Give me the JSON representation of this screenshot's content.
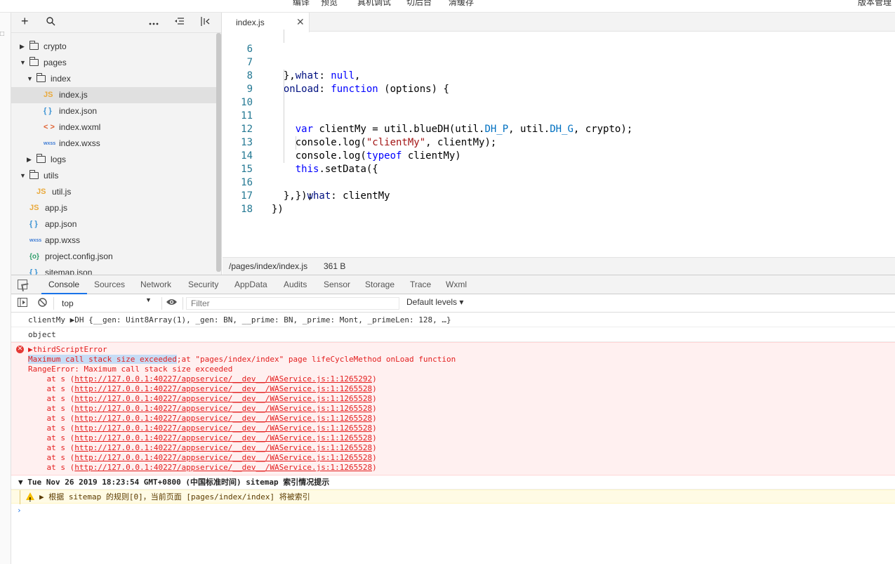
{
  "toolbar": {
    "items": [
      "编译",
      "预览",
      "真机调试",
      "切后台",
      "清缓存"
    ],
    "right": "版本管理"
  },
  "explorer": {
    "tree": [
      {
        "label": "crypto",
        "type": "folder",
        "expanded": false,
        "depth": 0
      },
      {
        "label": "pages",
        "type": "folder",
        "expanded": true,
        "depth": 0
      },
      {
        "label": "index",
        "type": "folder",
        "expanded": true,
        "depth": 1
      },
      {
        "label": "index.js",
        "type": "js",
        "depth": 2,
        "selected": true
      },
      {
        "label": "index.json",
        "type": "json",
        "depth": 2
      },
      {
        "label": "index.wxml",
        "type": "wxml",
        "depth": 2
      },
      {
        "label": "index.wxss",
        "type": "wxss",
        "depth": 2
      },
      {
        "label": "logs",
        "type": "folder",
        "expanded": false,
        "depth": 1
      },
      {
        "label": "utils",
        "type": "folder",
        "expanded": true,
        "depth": 0
      },
      {
        "label": "util.js",
        "type": "js",
        "depth": 1
      },
      {
        "label": "app.js",
        "type": "js",
        "depth": 0
      },
      {
        "label": "app.json",
        "type": "json",
        "depth": 0
      },
      {
        "label": "app.wxss",
        "type": "wxss",
        "depth": 0
      },
      {
        "label": "project.config.json",
        "type": "cfg",
        "depth": 0
      },
      {
        "label": "sitemap.json",
        "type": "json",
        "depth": 0
      }
    ]
  },
  "icons": {
    "js": "JS",
    "json": "{ }",
    "wxml": "< >",
    "wxss": "wxss",
    "cfg": "{o}"
  },
  "editor": {
    "tab_label": "index.js",
    "lines": [
      {
        "n": "6",
        "code": "    what: null,"
      },
      {
        "n": "7",
        "code": "  },"
      },
      {
        "n": "8",
        "code": "  onLoad: function (options) {"
      },
      {
        "n": "9",
        "code": ""
      },
      {
        "n": "10",
        "code": "    var clientMy = util.blueDH(util.DH_P, util.DH_G, crypto);"
      },
      {
        "n": "11",
        "code": "    console.log(\"clientMy\", clientMy);"
      },
      {
        "n": "12",
        "code": "    console.log(typeof clientMy)"
      },
      {
        "n": "13",
        "code": "    this.setData({"
      },
      {
        "n": "14",
        "code": "      what: clientMy"
      },
      {
        "n": "15",
        "code": "    });"
      },
      {
        "n": "16",
        "code": "  },"
      },
      {
        "n": "17",
        "code": "})"
      },
      {
        "n": "18",
        "code": ""
      }
    ],
    "status_path": "/pages/index/index.js",
    "status_size": "361 B"
  },
  "devtools": {
    "tabs": [
      "Console",
      "Sources",
      "Network",
      "Security",
      "AppData",
      "Audits",
      "Sensor",
      "Storage",
      "Trace",
      "Wxml"
    ],
    "active_tab": "Console",
    "context": "top",
    "filter_placeholder": "Filter",
    "levels": "Default levels ▾"
  },
  "console": {
    "log1": "clientMy ▶DH {__gen: Uint8Array(1), _gen: BN, __prime: BN, _prime: Mont, _primeLen: 128, …}",
    "log2": "object",
    "error_head": "▶thirdScriptError",
    "error_highlight": "Maximum call stack size exceeded",
    "error_msg_rest": ";at \"pages/index/index\" page lifeCycleMethod onLoad function",
    "error_type": "RangeError: Maximum call stack size exceeded",
    "stack_prefix": "    at s (",
    "stack_suffix": ")",
    "stack": [
      "http://127.0.0.1:40227/appservice/__dev__/WAService.js:1:1265292",
      "http://127.0.0.1:40227/appservice/__dev__/WAService.js:1:1265528",
      "http://127.0.0.1:40227/appservice/__dev__/WAService.js:1:1265528",
      "http://127.0.0.1:40227/appservice/__dev__/WAService.js:1:1265528",
      "http://127.0.0.1:40227/appservice/__dev__/WAService.js:1:1265528",
      "http://127.0.0.1:40227/appservice/__dev__/WAService.js:1:1265528",
      "http://127.0.0.1:40227/appservice/__dev__/WAService.js:1:1265528",
      "http://127.0.0.1:40227/appservice/__dev__/WAService.js:1:1265528",
      "http://127.0.0.1:40227/appservice/__dev__/WAService.js:1:1265528",
      "http://127.0.0.1:40227/appservice/__dev__/WAService.js:1:1265528"
    ],
    "group_head": "▼ Tue Nov 26 2019 18:23:54 GMT+0800 (中国标准时间) sitemap 索引情况提示",
    "warn_text": "▶ 根据 sitemap 的规则[0]，当前页面 [pages/index/index] 将被索引",
    "prompt": "›"
  }
}
